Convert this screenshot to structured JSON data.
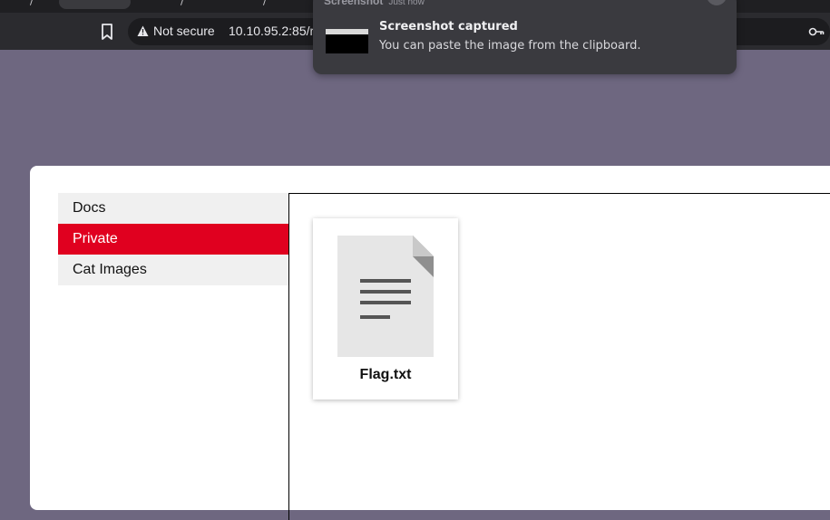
{
  "browser": {
    "security_label": "Not secure",
    "url": "10.10.95.2:85/r",
    "tab_glyphs": [
      "/",
      "/",
      "/"
    ]
  },
  "notification": {
    "app_name": "Screenshot",
    "time": "Just now",
    "title": "Screenshot captured",
    "body": "You can paste the image from the clipboard.",
    "close_glyph": "×"
  },
  "sidebar": {
    "items": [
      {
        "label": "Docs",
        "active": false
      },
      {
        "label": "Private",
        "active": true
      },
      {
        "label": "Cat Images",
        "active": false
      }
    ]
  },
  "files": [
    {
      "name": "Flag.txt",
      "icon": "text-file-icon"
    }
  ],
  "colors": {
    "accent": "#e0001f",
    "page_background": "#6e6780"
  }
}
